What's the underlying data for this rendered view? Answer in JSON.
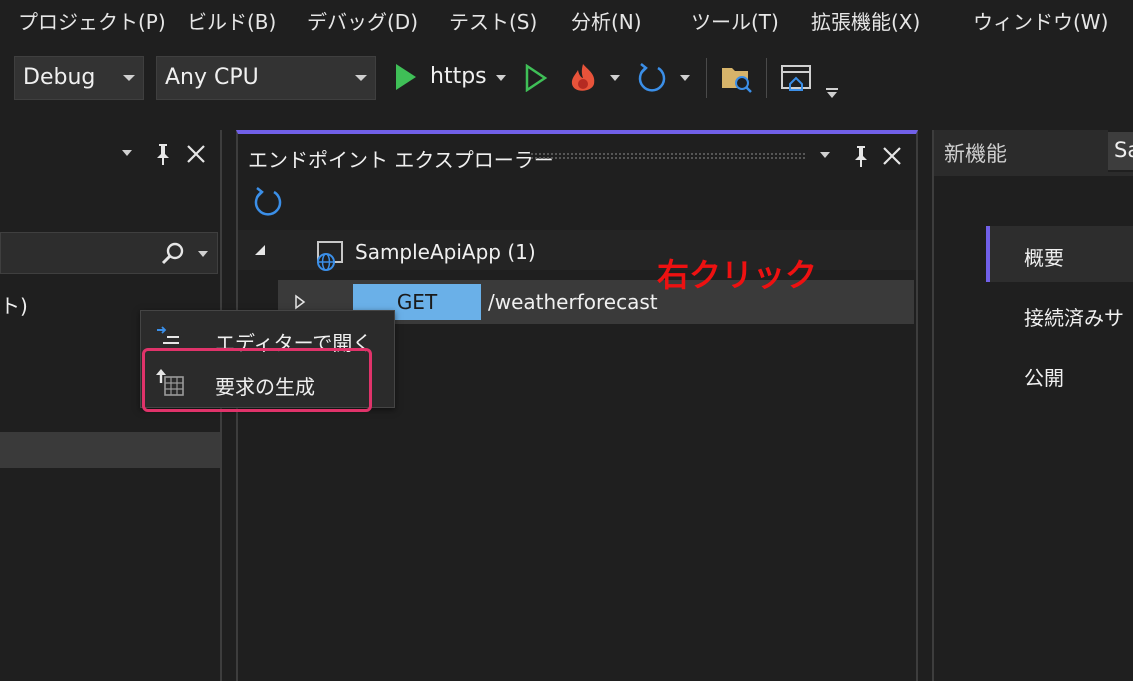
{
  "menubar": {
    "items": [
      "プロジェクト(P)",
      "ビルド(B)",
      "デバッグ(D)",
      "テスト(S)",
      "分析(N)",
      "ツール(T)",
      "拡張機能(X)",
      "ウィンドウ(W)"
    ]
  },
  "toolbar": {
    "config_value": "Debug",
    "platform_value": "Any CPU",
    "run_profile_label": "https",
    "icons": [
      "play-icon",
      "start-without-debugging-icon",
      "hot-reload-icon",
      "refresh-icon",
      "open-folder-icon",
      "browser-link-icon"
    ],
    "colors": {
      "play": "#3fbf57",
      "hot_reload": "#e8533a",
      "refresh": "#3b8fe8",
      "folder": "#d7b46a"
    }
  },
  "left_panel": {
    "partial_text": "ト)"
  },
  "endpoint_explorer": {
    "title": "エンドポイント エクスプローラー",
    "project_node": "SampleApiApp (1)",
    "endpoint": {
      "method": "GET",
      "route": "/weatherforecast"
    },
    "accent_color": "#7160e8",
    "method_badge_color": "#6ab0e8"
  },
  "context_menu": {
    "items": [
      {
        "label": "エディターで開く",
        "icon": "open-in-editor-icon"
      },
      {
        "label": "要求の生成",
        "icon": "generate-request-icon"
      }
    ],
    "highlight_color": "#e0336a"
  },
  "annotation": {
    "text": "右クリック",
    "color": "#ee1111"
  },
  "right_panel": {
    "tab_label": "新機能",
    "tab_partial": "Sa",
    "nav_items": [
      "概要",
      "接続済みサ",
      "公開"
    ]
  }
}
